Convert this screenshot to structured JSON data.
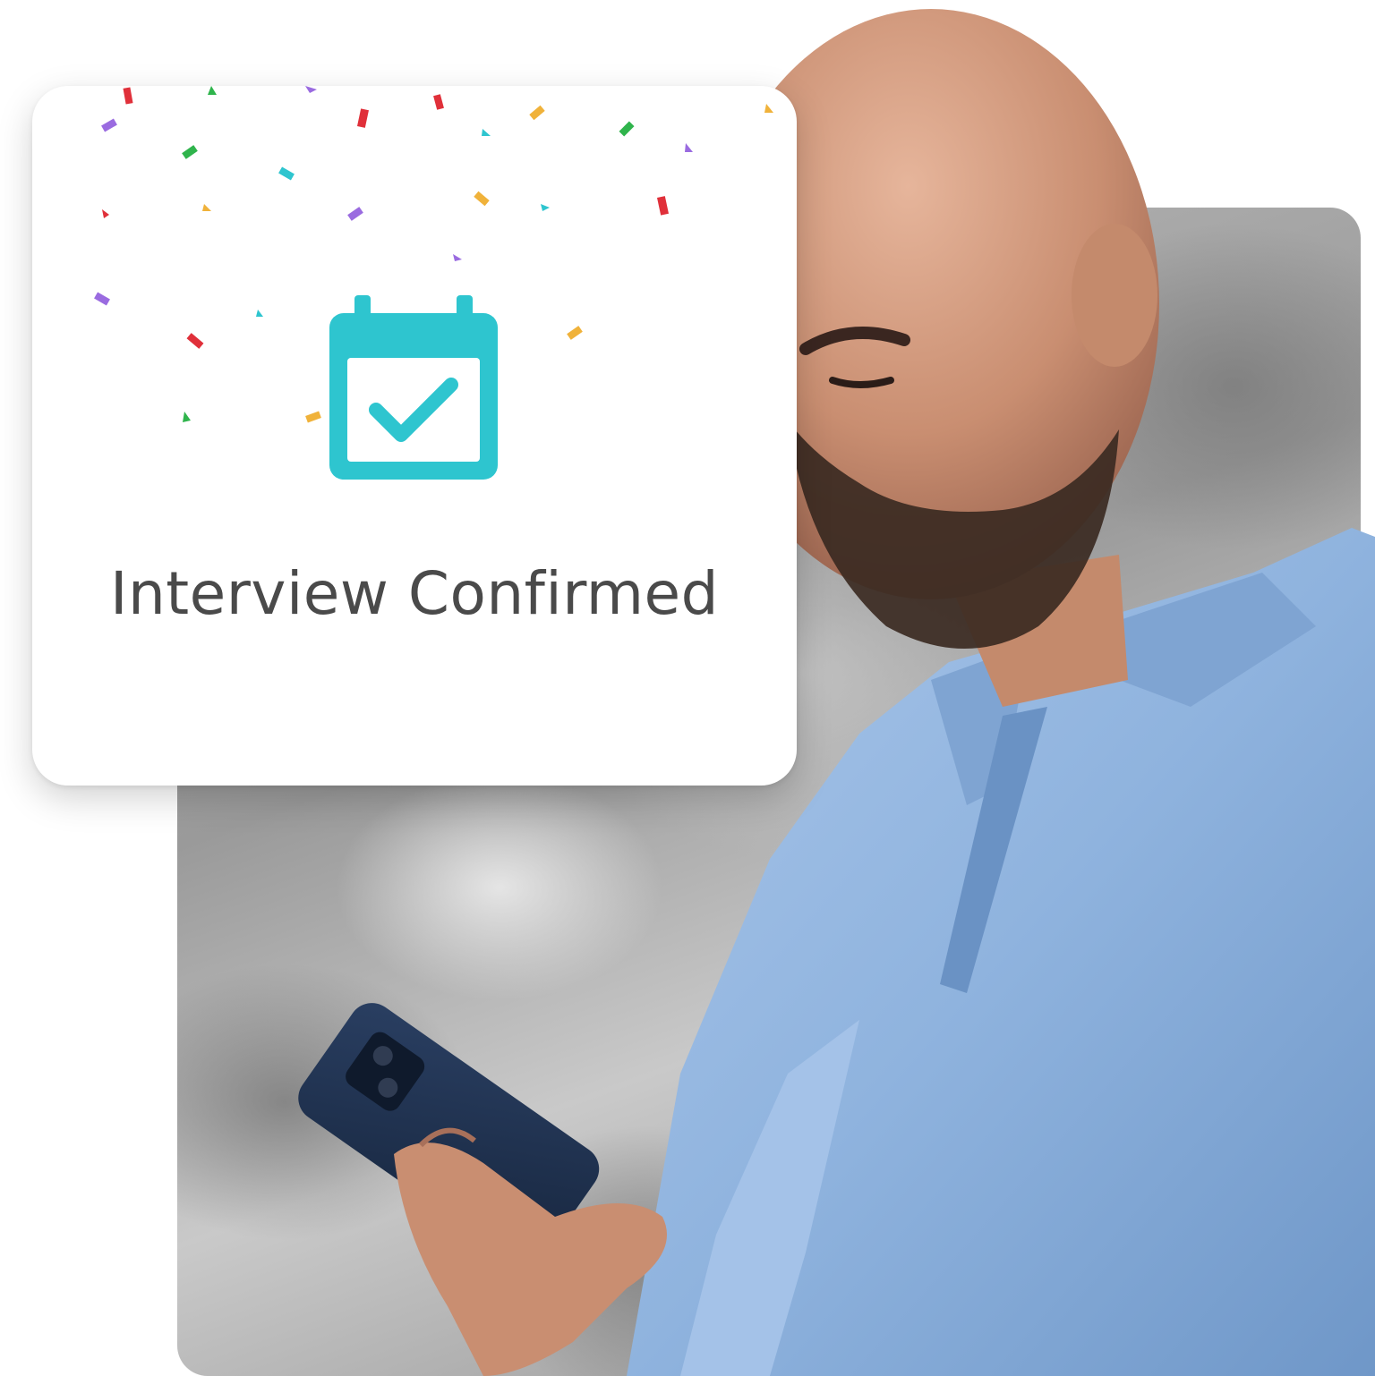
{
  "card": {
    "title": "Interview Confirmed",
    "icon": "calendar-check-icon",
    "accent_color": "#2ec5cf"
  },
  "confetti_colors": [
    "#e0303a",
    "#2fb44c",
    "#9a6be0",
    "#2ec5cf",
    "#f0b23a"
  ],
  "photo": {
    "subject": "man-with-phone",
    "shirt_color": "#8fb3de"
  }
}
